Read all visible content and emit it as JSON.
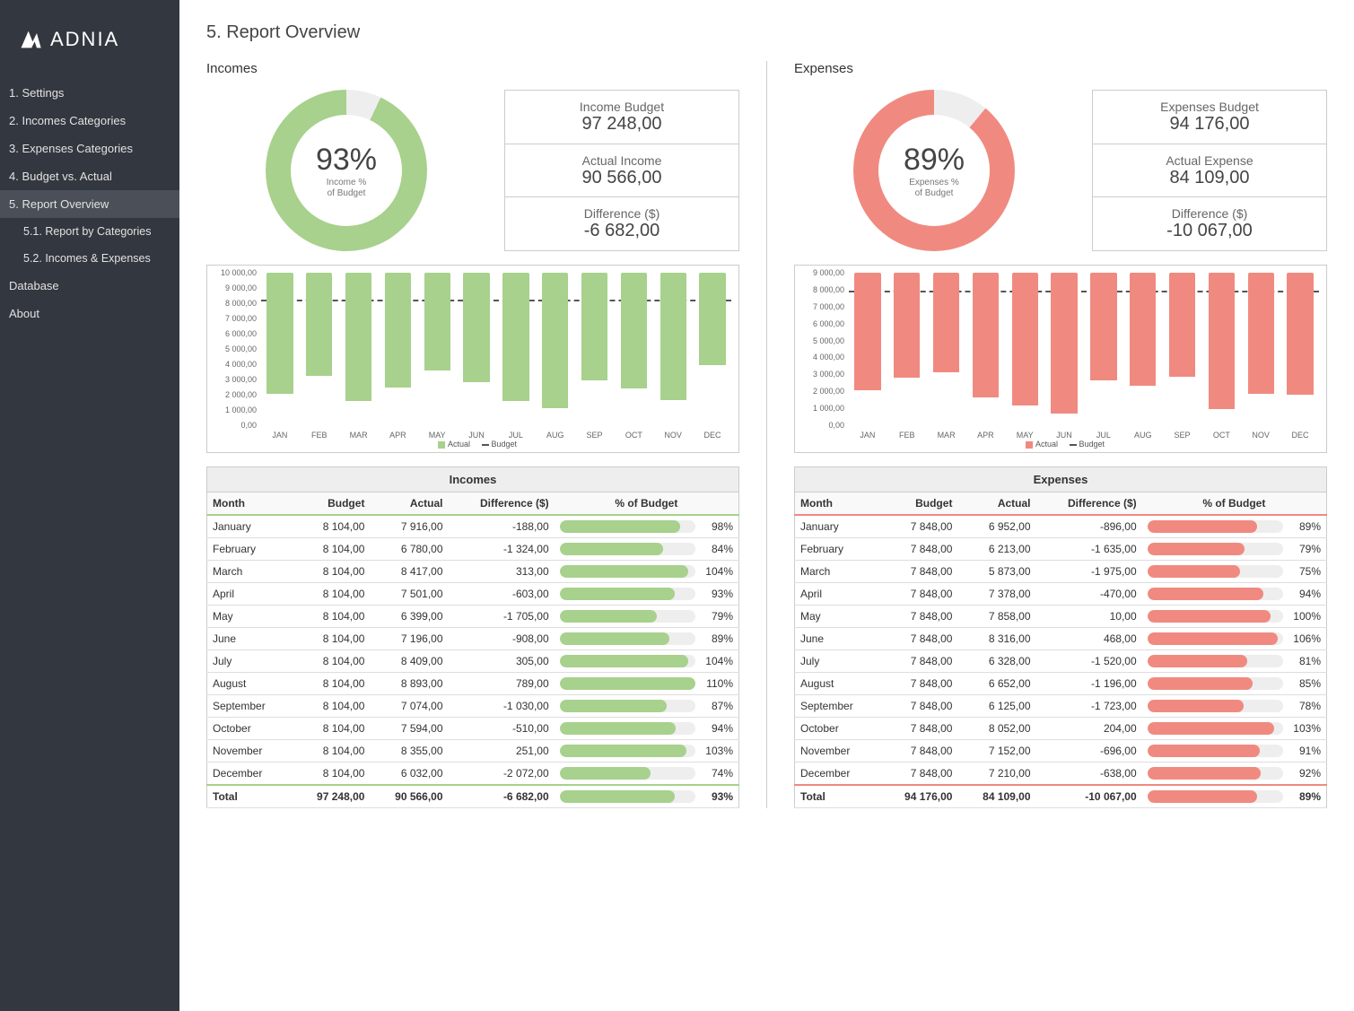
{
  "brand": "ADNIA",
  "page_title": "5. Report Overview",
  "nav": [
    {
      "label": "1. Settings",
      "active": false,
      "sub": false
    },
    {
      "label": "2. Incomes Categories",
      "active": false,
      "sub": false
    },
    {
      "label": "3. Expenses Categories",
      "active": false,
      "sub": false
    },
    {
      "label": "4. Budget vs. Actual",
      "active": false,
      "sub": false
    },
    {
      "label": "5. Report Overview",
      "active": true,
      "sub": false
    },
    {
      "label": "5.1. Report by Categories",
      "active": false,
      "sub": true
    },
    {
      "label": "5.2. Incomes & Expenses",
      "active": false,
      "sub": true
    },
    {
      "label": "Database",
      "active": false,
      "sub": false
    },
    {
      "label": "About",
      "active": false,
      "sub": false
    }
  ],
  "colors": {
    "income": "#a7d18c",
    "expense": "#f08a80",
    "budget_dash": "#555"
  },
  "incomes": {
    "title": "Incomes",
    "donut": {
      "pct": "93%",
      "label1": "Income %",
      "label2": "of Budget",
      "value": 93
    },
    "kpi": [
      {
        "label": "Income Budget",
        "value": "97 248,00"
      },
      {
        "label": "Actual Income",
        "value": "90 566,00"
      },
      {
        "label": "Difference ($)",
        "value": "-6 682,00"
      }
    ],
    "legend_actual": "Actual",
    "legend_budget": "Budget",
    "table": {
      "caption": "Incomes",
      "headers": [
        "Month",
        "Budget",
        "Actual",
        "Difference ($)",
        "% of Budget"
      ],
      "rows": [
        {
          "month": "January",
          "budget": "8 104,00",
          "actual": "7 916,00",
          "diff": "-188,00",
          "pct": 98
        },
        {
          "month": "February",
          "budget": "8 104,00",
          "actual": "6 780,00",
          "diff": "-1 324,00",
          "pct": 84
        },
        {
          "month": "March",
          "budget": "8 104,00",
          "actual": "8 417,00",
          "diff": "313,00",
          "pct": 104
        },
        {
          "month": "April",
          "budget": "8 104,00",
          "actual": "7 501,00",
          "diff": "-603,00",
          "pct": 93
        },
        {
          "month": "May",
          "budget": "8 104,00",
          "actual": "6 399,00",
          "diff": "-1 705,00",
          "pct": 79
        },
        {
          "month": "June",
          "budget": "8 104,00",
          "actual": "7 196,00",
          "diff": "-908,00",
          "pct": 89
        },
        {
          "month": "July",
          "budget": "8 104,00",
          "actual": "8 409,00",
          "diff": "305,00",
          "pct": 104
        },
        {
          "month": "August",
          "budget": "8 104,00",
          "actual": "8 893,00",
          "diff": "789,00",
          "pct": 110
        },
        {
          "month": "September",
          "budget": "8 104,00",
          "actual": "7 074,00",
          "diff": "-1 030,00",
          "pct": 87
        },
        {
          "month": "October",
          "budget": "8 104,00",
          "actual": "7 594,00",
          "diff": "-510,00",
          "pct": 94
        },
        {
          "month": "November",
          "budget": "8 104,00",
          "actual": "8 355,00",
          "diff": "251,00",
          "pct": 103
        },
        {
          "month": "December",
          "budget": "8 104,00",
          "actual": "6 032,00",
          "diff": "-2 072,00",
          "pct": 74
        }
      ],
      "total": {
        "month": "Total",
        "budget": "97 248,00",
        "actual": "90 566,00",
        "diff": "-6 682,00",
        "pct": 93
      }
    }
  },
  "expenses": {
    "title": "Expenses",
    "donut": {
      "pct": "89%",
      "label1": "Expenses %",
      "label2": "of Budget",
      "value": 89
    },
    "kpi": [
      {
        "label": "Expenses Budget",
        "value": "94 176,00"
      },
      {
        "label": "Actual Expense",
        "value": "84 109,00"
      },
      {
        "label": "Difference ($)",
        "value": "-10 067,00"
      }
    ],
    "legend_actual": "Actual",
    "legend_budget": "Budget",
    "table": {
      "caption": "Expenses",
      "headers": [
        "Month",
        "Budget",
        "Actual",
        "Difference ($)",
        "% of Budget"
      ],
      "rows": [
        {
          "month": "January",
          "budget": "7 848,00",
          "actual": "6 952,00",
          "diff": "-896,00",
          "pct": 89
        },
        {
          "month": "February",
          "budget": "7 848,00",
          "actual": "6 213,00",
          "diff": "-1 635,00",
          "pct": 79
        },
        {
          "month": "March",
          "budget": "7 848,00",
          "actual": "5 873,00",
          "diff": "-1 975,00",
          "pct": 75
        },
        {
          "month": "April",
          "budget": "7 848,00",
          "actual": "7 378,00",
          "diff": "-470,00",
          "pct": 94
        },
        {
          "month": "May",
          "budget": "7 848,00",
          "actual": "7 858,00",
          "diff": "10,00",
          "pct": 100
        },
        {
          "month": "June",
          "budget": "7 848,00",
          "actual": "8 316,00",
          "diff": "468,00",
          "pct": 106
        },
        {
          "month": "July",
          "budget": "7 848,00",
          "actual": "6 328,00",
          "diff": "-1 520,00",
          "pct": 81
        },
        {
          "month": "August",
          "budget": "7 848,00",
          "actual": "6 652,00",
          "diff": "-1 196,00",
          "pct": 85
        },
        {
          "month": "September",
          "budget": "7 848,00",
          "actual": "6 125,00",
          "diff": "-1 723,00",
          "pct": 78
        },
        {
          "month": "October",
          "budget": "7 848,00",
          "actual": "8 052,00",
          "diff": "204,00",
          "pct": 103
        },
        {
          "month": "November",
          "budget": "7 848,00",
          "actual": "7 152,00",
          "diff": "-696,00",
          "pct": 91
        },
        {
          "month": "December",
          "budget": "7 848,00",
          "actual": "7 210,00",
          "diff": "-638,00",
          "pct": 92
        }
      ],
      "total": {
        "month": "Total",
        "budget": "94 176,00",
        "actual": "84 109,00",
        "diff": "-10 067,00",
        "pct": 89
      }
    }
  },
  "chart_data": [
    {
      "type": "bar",
      "title": "Incomes monthly",
      "categories": [
        "JAN",
        "FEB",
        "MAR",
        "APR",
        "MAY",
        "JUN",
        "JUL",
        "AUG",
        "SEP",
        "OCT",
        "NOV",
        "DEC"
      ],
      "series": [
        {
          "name": "Actual",
          "values": [
            7916,
            6780,
            8417,
            7501,
            6399,
            7196,
            8409,
            8893,
            7074,
            7594,
            8355,
            6032
          ]
        }
      ],
      "budget_line": 8104,
      "ylim": [
        0,
        10000
      ],
      "yticks": [
        "0,00",
        "1 000,00",
        "2 000,00",
        "3 000,00",
        "4 000,00",
        "5 000,00",
        "6 000,00",
        "7 000,00",
        "8 000,00",
        "9 000,00",
        "10 000,00"
      ]
    },
    {
      "type": "bar",
      "title": "Expenses monthly",
      "categories": [
        "JAN",
        "FEB",
        "MAR",
        "APR",
        "MAY",
        "JUN",
        "JUL",
        "AUG",
        "SEP",
        "OCT",
        "NOV",
        "DEC"
      ],
      "series": [
        {
          "name": "Actual",
          "values": [
            6952,
            6213,
            5873,
            7378,
            7858,
            8316,
            6328,
            6652,
            6125,
            8052,
            7152,
            7210
          ]
        }
      ],
      "budget_line": 7848,
      "ylim": [
        0,
        9000
      ],
      "yticks": [
        "0,00",
        "1 000,00",
        "2 000,00",
        "3 000,00",
        "4 000,00",
        "5 000,00",
        "6 000,00",
        "7 000,00",
        "8 000,00",
        "9 000,00"
      ]
    }
  ]
}
